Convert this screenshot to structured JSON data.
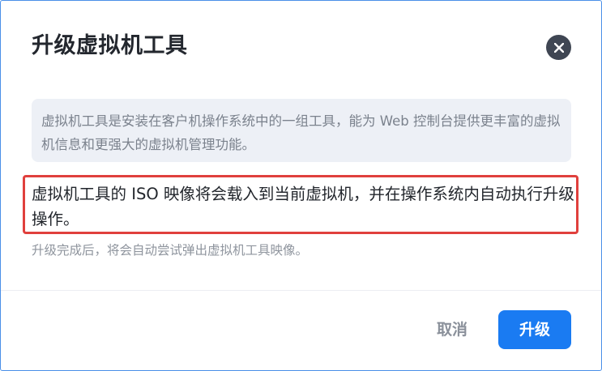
{
  "dialog": {
    "title": "升级虚拟机工具",
    "close_icon": "close-icon",
    "info": "虚拟机工具是安装在客户机操作系统中的一组工具，能为 Web 控制台提供更丰富的虚拟机信息和更强大的虚拟机管理功能。",
    "main_text": "虚拟机工具的 ISO 映像将会载入到当前虚拟机，并在操作系统内自动执行升级操作。",
    "hint": "升级完成后，将会自动尝试弹出虚拟机工具映像。",
    "cancel_label": "取消",
    "upgrade_label": "升级"
  },
  "colors": {
    "primary": "#1a7bf2",
    "highlight_border": "#e0403d",
    "info_bg": "#edf0f6",
    "close_bg": "#3f4653"
  }
}
